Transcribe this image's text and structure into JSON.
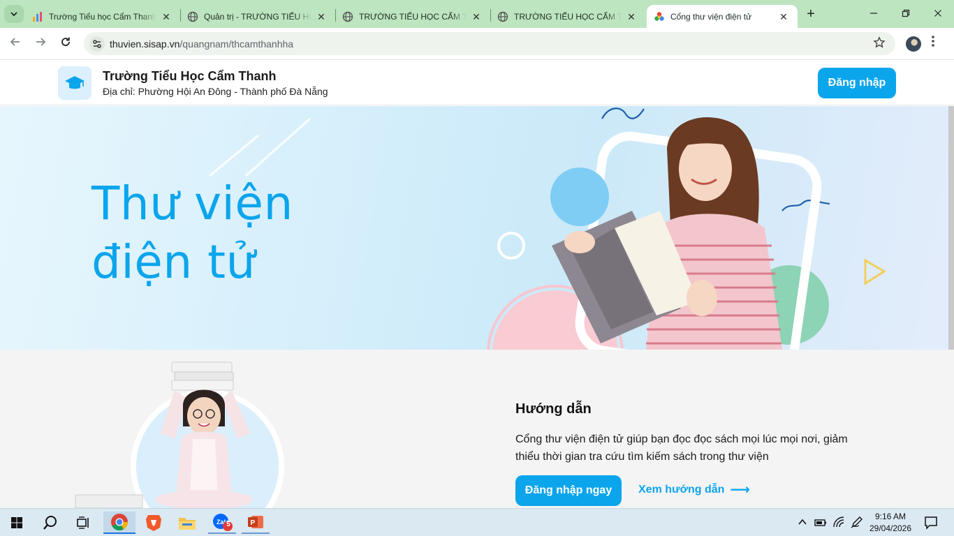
{
  "browser": {
    "tabs": [
      {
        "title": "Trường Tiểu học Cẩm Thanh",
        "favicon": "chart-favicon-icon",
        "active": false
      },
      {
        "title": "Quản trị - TRƯỜNG TIỂU HỌ",
        "favicon": "globe-icon",
        "active": false
      },
      {
        "title": "TRƯỜNG TIỂU HỌC CẨM TH",
        "favicon": "globe-icon",
        "active": false
      },
      {
        "title": "TRƯỜNG TIỂU HỌC CẨM TH",
        "favicon": "globe-icon",
        "active": false
      },
      {
        "title": "Cổng thư viện điện tử",
        "favicon": "colorful-favicon-icon",
        "active": true
      }
    ],
    "url_host": "thuvien.sisap.vn",
    "url_path": "/quangnam/thcamthanhha",
    "close_glyph": "✕",
    "new_tab_glyph": "+"
  },
  "header": {
    "school_name": "Trường Tiểu Học Cẩm Thanh",
    "address": "Địa chỉ: Phường Hội An Đông - Thành phố Đà Nẵng",
    "login_label": "Đăng nhập",
    "logo_icon": "graduation-cap-icon"
  },
  "hero": {
    "title_line1": "Thư viện",
    "title_line2": "điện tử"
  },
  "guide": {
    "title": "Hướng dẫn",
    "description": "Cổng thư viện điện tử giúp bạn đọc đọc sách mọi lúc mọi nơi, giảm thiểu thời gian tra cứu tìm kiếm sách trong thư viện",
    "login_now_label": "Đăng nhập ngay",
    "view_guide_label": "Xem hướng dẫn",
    "arrow": "⟶"
  },
  "taskbar": {
    "time": "9:16 AM",
    "date": "29/04/2026",
    "zalo_badge": "5"
  },
  "colors": {
    "accent": "#0ba5ec",
    "tab_strip": "#bde5c0"
  }
}
